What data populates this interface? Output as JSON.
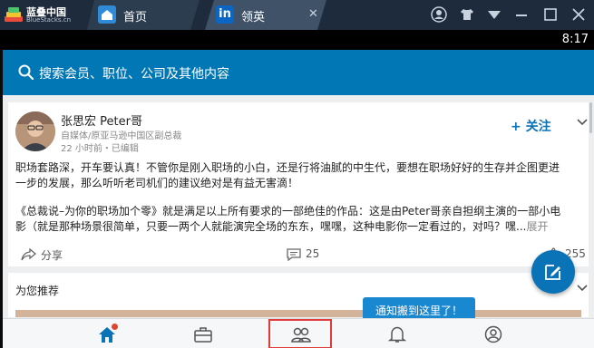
{
  "emulator": {
    "brand_name": "蓝叠中国",
    "brand_sub": "BlueStacks.cn",
    "tabs": [
      {
        "label": "首页",
        "icon": "home-icon"
      },
      {
        "label": "领英",
        "icon": "linkedin-icon",
        "icon_text": "in"
      }
    ],
    "controls": [
      "account-icon",
      "shirt-icon",
      "wifi-icon",
      "minimize-icon",
      "maximize-icon",
      "close-icon"
    ]
  },
  "status_bar": {
    "time": "8:17"
  },
  "search": {
    "placeholder": "搜索会员、职位、公司及其他内容"
  },
  "post": {
    "author_name": "张思宏 Peter哥",
    "author_title": "自媒体/原亚马逊中国区副总裁",
    "time": "22 小时前・已编辑",
    "follow_label": "+ 关注",
    "paragraph1": "职场套路深，开车要认真！不管你是刚入职场的小白，还是行将油腻的中生代，要想在职场好好的生存并企图更进一步的发展，那么听听老司机们的建议绝对是有益无害滴！",
    "paragraph2": "《总裁说–为你的职场加个零》就是满足以上所有要求的一部绝佳的作品：这是由Peter哥亲自担纲主演的一部小电影（就是那种场景很简单，只要一两个人就能演完全场的东东，嘿嘿，这种电影你一定看过的，对吗？嘿...",
    "more_label": "展开",
    "share_label": "分享",
    "comment_count": "25",
    "like_count": "255"
  },
  "recommend": {
    "title": "为您推荐"
  },
  "tooltip": {
    "text": "通知搬到这里了！"
  },
  "bottom_nav": [
    {
      "name": "home",
      "icon": "home-icon",
      "active": true
    },
    {
      "name": "jobs",
      "icon": "briefcase-icon"
    },
    {
      "name": "network",
      "icon": "people-icon"
    },
    {
      "name": "notifications",
      "icon": "bell-icon"
    },
    {
      "name": "me",
      "icon": "profile-icon"
    }
  ],
  "colors": {
    "primary": "#0277b5",
    "accent": "#0a72b6",
    "tooltip": "#1a88d0",
    "badge": "#e0452f",
    "highlight": "#e03a3a"
  }
}
